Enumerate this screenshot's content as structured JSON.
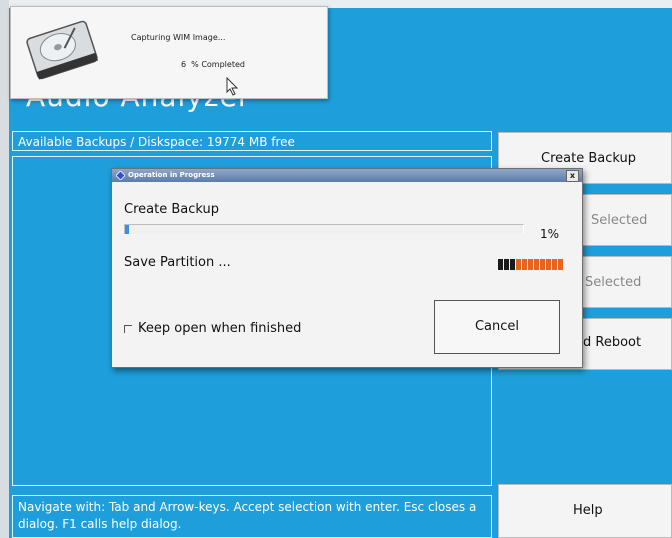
{
  "app": {
    "title": "Audio Analyzer"
  },
  "wim_popup": {
    "title": "Capturing WIM Image...",
    "progress_text": "6  % Completed"
  },
  "backups": {
    "header": "Available Backups / Diskspace: 19774 MB free"
  },
  "status_bar": {
    "text": "Navigate with: Tab and Arrow-keys. Accept selection with enter. Esc closes a dialog. F1 calls help dialog."
  },
  "side_buttons": {
    "create_backup": "Create Backup",
    "btn2_partial": "Selected",
    "btn3_partial": "Selected",
    "btn4_partial": "d Reboot",
    "help": "Help"
  },
  "dialog": {
    "title": "Operation in Progress",
    "close_glyph": "x",
    "task": "Create Backup",
    "progress_percent_text": "1%",
    "progress_value": 0.01,
    "step": "Save Partition ...",
    "keep_open_label": "Keep open when finished",
    "keep_open_checked": false,
    "cancel_label": "Cancel"
  },
  "colors": {
    "background": "#1e9fdc",
    "activity_active": "#1a1a1a",
    "activity_idle": "#e8641c",
    "dialog_title_bar": "#5d7cab"
  },
  "icons": {
    "wim_icon": "hard-drive-icon",
    "dialog_icon": "app-icon",
    "pointer": "mouse-cursor-icon"
  }
}
